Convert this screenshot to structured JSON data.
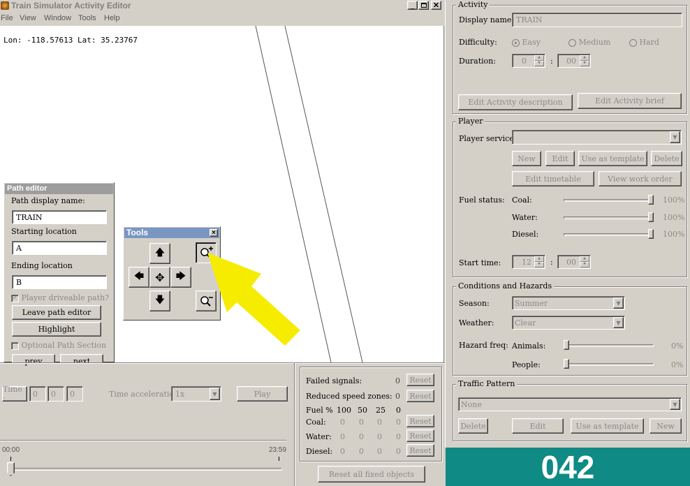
{
  "window": {
    "title": "Train Simulator Activity Editor"
  },
  "menu": [
    "File",
    "View",
    "Window",
    "Tools",
    "Help"
  ],
  "map": {
    "coords": "Lon: -118.57613 Lat: 35.23767"
  },
  "path_editor": {
    "title": "Path editor",
    "display_name_label": "Path display name:",
    "display_name_value": "TRAIN",
    "start_label": "Starting location",
    "start_value": "A",
    "end_label": "Ending location",
    "end_value": "B",
    "driveable_label": "Player driveable path?",
    "leave_label": "Leave path editor",
    "highlight_label": "Highlight",
    "optional_label": "Optional Path Section",
    "prev_label": "prev",
    "next_label": "next"
  },
  "tools": {
    "title": "Tools",
    "close": "×"
  },
  "bottom": {
    "time_label": "Time :",
    "time_values": [
      "0",
      "0",
      "0"
    ],
    "accel_label": "Time acceleration",
    "accel_value": "1x",
    "play_label": "Play",
    "start_time": "00:00",
    "end_time": "23:59",
    "slider_position": 0.0
  },
  "stats": {
    "failed_label": "Failed signals:",
    "failed_value": "0",
    "reduced_label": "Reduced speed zones:",
    "reduced_value": "0",
    "reset_label": "Reset",
    "fuel_header": [
      "Fuel %",
      "100",
      "50",
      "25",
      "0"
    ],
    "rows": [
      {
        "label": "Coal:",
        "values": [
          "0",
          "0",
          "0",
          "0"
        ]
      },
      {
        "label": "Water:",
        "values": [
          "0",
          "0",
          "0",
          "0"
        ]
      },
      {
        "label": "Diesel:",
        "values": [
          "0",
          "0",
          "0",
          "0"
        ]
      }
    ],
    "reset_all_label": "Reset all fixed objects"
  },
  "activity": {
    "legend": "Activity",
    "display_name_label": "Display name:",
    "display_name_value": "TRAIN",
    "difficulty_label": "Difficulty:",
    "difficulty_options": [
      "Easy",
      "Medium",
      "Hard"
    ],
    "difficulty_selected": "Easy",
    "duration_label": "Duration:",
    "duration_hours": "0",
    "duration_minutes": "00",
    "edit_description_label": "Edit Activity description",
    "edit_brief_label": "Edit Activity brief"
  },
  "player": {
    "legend": "Player",
    "service_label": "Player service:",
    "new_label": "New",
    "edit_label": "Edit",
    "template_label": "Use as template",
    "delete_label": "Delete",
    "timetable_label": "Edit timetable",
    "work_order_label": "View work order",
    "fuel_label": "Fuel status:",
    "coal_label": "Coal:",
    "coal_value": "100%",
    "coal_level": 1.0,
    "water_label": "Water:",
    "water_value": "100%",
    "water_level": 1.0,
    "diesel_label": "Diesel:",
    "diesel_value": "100%",
    "diesel_level": 1.0,
    "start_time_label": "Start time:",
    "start_hours": "12",
    "start_minutes": "00"
  },
  "conditions": {
    "legend": "Conditions and Hazards",
    "season_label": "Season:",
    "season_value": "Summer",
    "weather_label": "Weather:",
    "weather_value": "Clear",
    "hazard_label": "Hazard freq:",
    "animals_label": "Animals:",
    "animals_value": "0%",
    "animals_level": 0.0,
    "people_label": "People:",
    "people_value": "0%",
    "people_level": 0.0
  },
  "traffic": {
    "legend": "Traffic Pattern",
    "value": "None",
    "delete_label": "Delete",
    "edit_label": "Edit",
    "template_label": "Use as template",
    "new_label": "New"
  },
  "badge": {
    "number": "042",
    "color": "#0f8a84"
  },
  "colors": {
    "highlight_arrow": "#f5ec00",
    "titlebar_active": "#7a96c2"
  }
}
